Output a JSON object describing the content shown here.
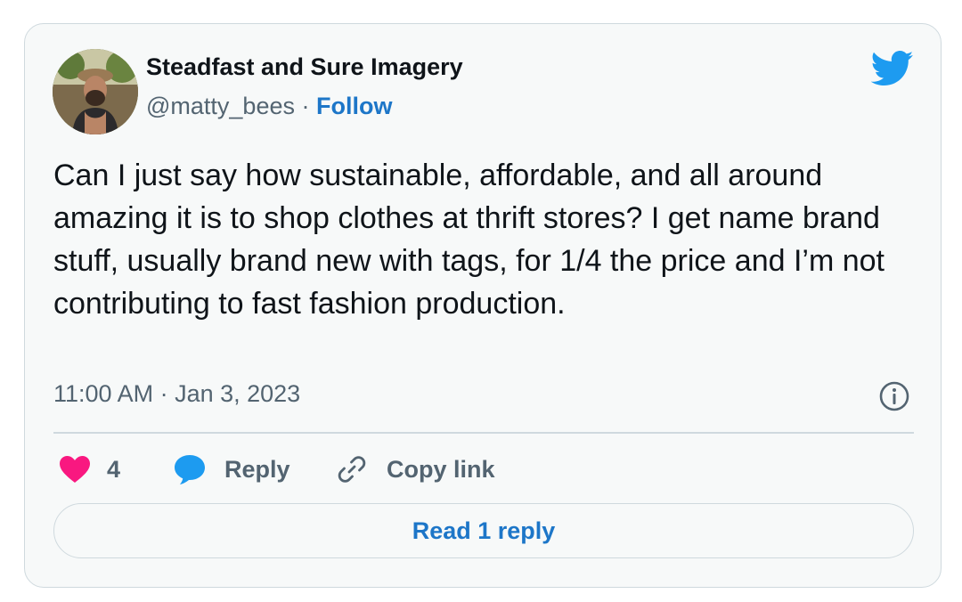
{
  "author": {
    "name": "Steadfast and Sure Imagery",
    "handle": "@matty_bees",
    "separator": "·",
    "follow_label": "Follow"
  },
  "tweet": {
    "text": "Can I just say how sustainable, affordable, and all around amazing it is to shop clothes at thrift stores? I get name brand stuff, usually brand new with tags, for 1/4 the price and I’m not contributing to fast fashion production.",
    "timestamp": "11:00 AM · Jan 3, 2023"
  },
  "actions": {
    "like_count": "4",
    "reply_label": "Reply",
    "copy_link_label": "Copy link",
    "read_replies_label": "Read 1 reply"
  },
  "icons": {
    "brand": "twitter-bird-icon",
    "info": "info-icon",
    "like": "heart-icon",
    "reply": "speech-bubble-icon",
    "copy": "link-icon"
  },
  "colors": {
    "link_blue": "#1d76c8",
    "twitter_blue": "#1d9bf0",
    "heart_pink": "#f91880",
    "text_primary": "#0f1419",
    "text_secondary": "#536471",
    "border": "#cfd9de",
    "card_bg": "#f7f9f9"
  }
}
